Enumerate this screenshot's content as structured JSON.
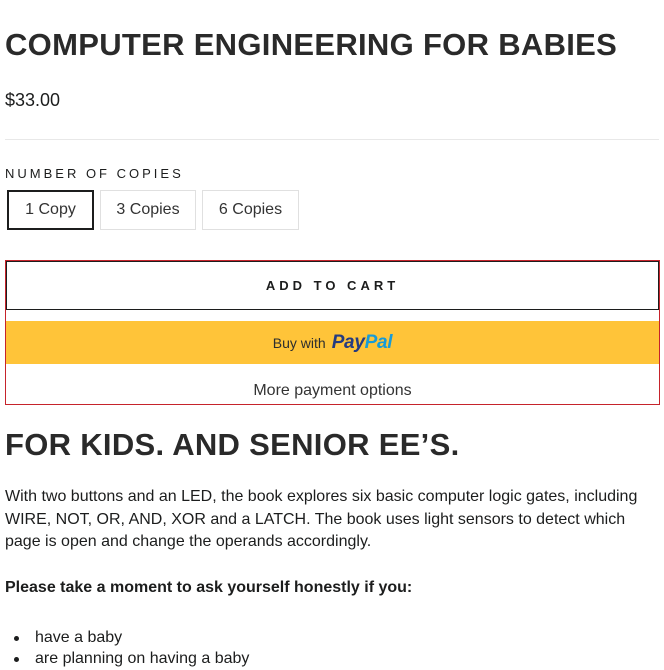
{
  "product": {
    "title": "COMPUTER ENGINEERING FOR BABIES",
    "price": "$33.00"
  },
  "variants": {
    "label": "NUMBER OF COPIES",
    "options": [
      "1 Copy",
      "3 Copies",
      "6 Copies"
    ],
    "selected": "1 Copy"
  },
  "buttons": {
    "add_to_cart": "ADD TO CART",
    "paypal_prefix": "Buy with",
    "paypal_logo_pay": "Pay",
    "paypal_logo_pal": "Pal",
    "more_options": "More payment options"
  },
  "description": {
    "heading": "FOR KIDS. AND SENIOR EE’S.",
    "paragraph": "With two buttons and an LED, the book explores six basic computer logic gates, including WIRE, NOT, OR, AND, XOR and a LATCH. The book uses light sensors to detect which page is open and change the operands accordingly.",
    "question": "Please take a moment to ask yourself honestly if you:",
    "bullets": [
      "have a baby",
      "are planning on having a baby"
    ]
  },
  "colors": {
    "paypal_yellow": "#ffc439",
    "paypal_dark_blue": "#253b80",
    "paypal_light_blue": "#179bd7",
    "outline_red": "#c6232b"
  }
}
